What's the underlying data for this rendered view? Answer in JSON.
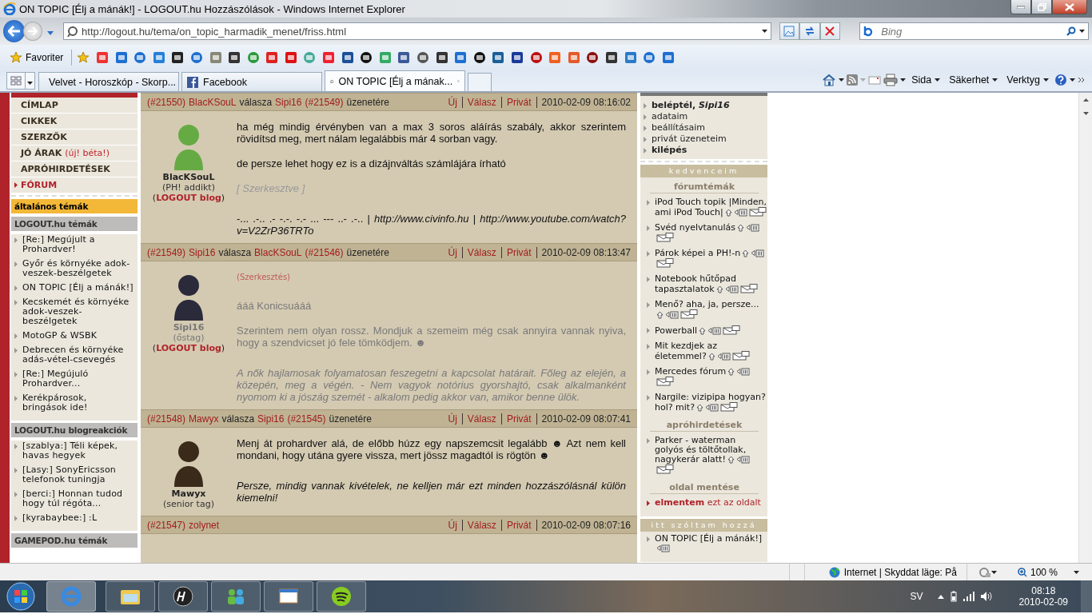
{
  "window": {
    "title": "ON TOPIC [Élj a mánák!] - LOGOUT.hu Hozzászólások - Windows Internet Explorer"
  },
  "address_bar": {
    "url": "http://logout.hu/tema/on_topic_harmadik_menet/friss.html"
  },
  "search": {
    "placeholder": "Bing"
  },
  "favorites": {
    "label": "Favoriter"
  },
  "tabs": [
    {
      "label": "Velvet - Horoszkóp - Skorp...",
      "selected": false,
      "kind": "velvet"
    },
    {
      "label": "Facebook",
      "selected": false,
      "kind": "facebook"
    },
    {
      "label": "ON TOPIC [Élj a mának...",
      "selected": true,
      "kind": "logout"
    }
  ],
  "command_bar": [
    {
      "label": "Sida"
    },
    {
      "label": "Säkerhet"
    },
    {
      "label": "Verktyg"
    }
  ],
  "site_menu": [
    {
      "label": "CÍMLAP",
      "selected": false
    },
    {
      "label": "CIKKEK",
      "selected": false
    },
    {
      "label": "SZERZŐK",
      "selected": false
    },
    {
      "label": "JÓ ÁRAK",
      "note": "(új! béta!)",
      "selected": false
    },
    {
      "label": "APRÓHIRDETÉSEK",
      "selected": false
    },
    {
      "label": "FÓRUM",
      "selected": true
    }
  ],
  "topic_sections": [
    {
      "title": "általános témák",
      "highlighted": true
    },
    {
      "title": "LOGOUT.hu témák",
      "highlighted": false,
      "items": [
        "[Re:] Megújult a Prohardver!",
        "Győr és környéke adok-veszek-beszélgetek",
        "ON TOPIC [Élj a mánák!]",
        "Kecskemét és környéke adok-veszek-beszélgetek",
        "MotoGP & WSBK",
        "Debrecen és környéke adás-vétel-csevegés",
        "[Re:] Megújuló Prohardver...",
        "Kerékpárosok, bringások ide!"
      ]
    },
    {
      "title": "LOGOUT.hu blogreakciók",
      "highlighted": false,
      "items": [
        "[szablya:] Téli képek, havas hegyek",
        "[Lasy:] SonyEricsson telefonok tuningja",
        "[berci:] Honnan tudod hogy túl régóta...",
        "[kyrabaybee:] :L"
      ]
    },
    {
      "title": "GAMEPOD.hu témák",
      "highlighted": false
    }
  ],
  "posts": [
    {
      "number": "(#21550)",
      "author": "BlacKSouL",
      "verb": "válasza",
      "reply_to": "Sipi16",
      "reply_number": "(#21549)",
      "suffix": "üzenetére",
      "actions": [
        "Új",
        "Válasz",
        "Privát"
      ],
      "time": "2010-02-09 08:16:02",
      "muted": false,
      "user": {
        "name": "BlacKSouL",
        "rank": "(PH! addikt)",
        "blog": "(**LOGOUT blog**)"
      },
      "paragraphs": [
        {
          "kind": "text",
          "text": "ha még mindig érvényben van a max 3 soros aláírás szabály, akkor szerintem rövidítsd meg, mert nálam legalábbis már 4 sorban vagy."
        },
        {
          "kind": "text",
          "text": "de persze lehet hogy ez is a dizájnváltás számlájára írható"
        },
        {
          "kind": "edited",
          "text": "[ Szerkesztve ]"
        },
        {
          "kind": "signature",
          "text": "-... .-.. .- -.-. -.- ... --- ..- .-.. | *http://www.civinfo.hu* | *http://www.youtube.com/watch?v=V2ZrP36TRTo*"
        }
      ]
    },
    {
      "number": "(#21549)",
      "author": "Sipi16",
      "verb": "válasza",
      "reply_to": "BlacKSouL",
      "reply_number": "(#21546)",
      "suffix": "üzenetére",
      "actions": [
        "Új",
        "Válasz",
        "Privát"
      ],
      "time": "2010-02-09 08:13:47",
      "muted": true,
      "user": {
        "name": "Sipi16",
        "rank": "(őstag)",
        "blog": "(**LOGOUT blog**)"
      },
      "paragraphs": [
        {
          "kind": "edit_link",
          "text": "(Szerkesztés)"
        },
        {
          "kind": "text",
          "text": "ááá Konicsuááá"
        },
        {
          "kind": "text",
          "text": "Szerintem nem olyan rossz. Mondjuk a szemeim még csak annyira vannak nyiva, hogy a szendvicset jó fele tömködjem. ☻"
        },
        {
          "kind": "quote",
          "text": "A nők hajlamosak folyamatosan feszegetni a kapcsolat határait. Főleg az elején, a közepén, meg a végén. - Nem vagyok notórius gyorshajtó, csak alkalmanként nyomom ki a jószág szemét - alkalom pedig akkor van, amikor benne ülök."
        }
      ]
    },
    {
      "number": "(#21548)",
      "author": "Mawyx",
      "verb": "válasza",
      "reply_to": "Sipi16",
      "reply_number": "(#21545)",
      "suffix": "üzenetére",
      "actions": [
        "Új",
        "Válasz",
        "Privát"
      ],
      "time": "2010-02-09 08:07:41",
      "muted": false,
      "user": {
        "name": "Mawyx",
        "rank": "(senior tag)"
      },
      "paragraphs": [
        {
          "kind": "text",
          "text": "Menj át prohardver alá, de előbb húzz egy napszemcsit legalább ☻ Azt nem kell mondani, hogy utána gyere vissza, mert jössz magadtól is rögtön ☻"
        },
        {
          "kind": "quote",
          "text": "Persze, mindig vannak kivételek, ne kelljen már ezt minden hozzászólásnál külön kiemelni!"
        }
      ]
    },
    {
      "number": "(#21547)",
      "author": "zolynet",
      "actions": [
        "Új",
        "Válasz",
        "Privát"
      ],
      "time": "2010-02-09 08:07:16"
    }
  ],
  "user_menu": [
    {
      "label": "beléptél, *Sipi16*",
      "bold": true
    },
    {
      "label": "adataim",
      "bold": false
    },
    {
      "label": "beállításaim",
      "bold": false
    },
    {
      "label": "privát üzeneteim",
      "bold": false
    },
    {
      "label": "kilépés",
      "bold": true
    }
  ],
  "side_panels": [
    {
      "title": "kedvenceim",
      "groups": [
        {
          "title": "fórumtémák",
          "items": [
            {
              "label": "iPod Touch topik |Minden, ami iPod Touch|",
              "kind": "topic"
            },
            {
              "label": "Svéd nyelvtanulás",
              "kind": "topic"
            },
            {
              "label": "Párok képei a PH!-n",
              "kind": "topic"
            },
            {
              "label": "Notebook hűtőpad tapasztalatok",
              "kind": "topic"
            },
            {
              "label": "Menő? aha, ja, persze...",
              "kind": "topic"
            },
            {
              "label": "Powerball",
              "kind": "topic"
            },
            {
              "label": "Mit kezdjek az életemmel?",
              "kind": "topic"
            },
            {
              "label": "Mercedes fórum",
              "kind": "topic"
            },
            {
              "label": "Nargile: vizipipa hogyan? hol? mit?",
              "kind": "topic"
            }
          ]
        },
        {
          "title": "apróhirdetések",
          "items": [
            {
              "label": "Parker - waterman golyós és töltőtollak, nagykerár alatt!",
              "kind": "topic"
            }
          ]
        },
        {
          "title": "oldal mentése",
          "items": [
            {
              "label": "**elmentem** ezt az oldalt",
              "kind": "save"
            }
          ]
        }
      ]
    },
    {
      "title": "itt szóltam hozzá",
      "groups": [
        {
          "items": [
            {
              "label": "ON TOPIC [Élj a mánák!]",
              "kind": "comment"
            }
          ]
        }
      ]
    }
  ],
  "status_bar": {
    "zone": "Internet | Skyddat läge: På",
    "zoom": "100 %"
  },
  "taskbar": {
    "language": "SV",
    "time": "08:18",
    "date": "2010-02-09"
  }
}
